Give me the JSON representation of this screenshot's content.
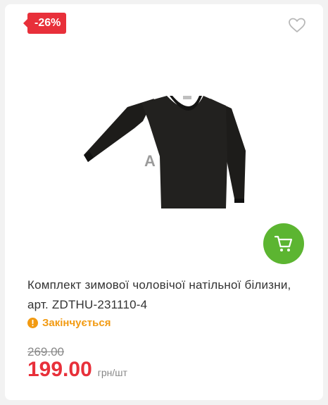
{
  "badge": {
    "discount": "-26%"
  },
  "icons": {
    "wishlist": "heart-icon",
    "cart": "cart-icon",
    "status": "exclamation-icon"
  },
  "product": {
    "title": "Комплект зимової чоловічої натільної білизни, арт. ZDTHU-231110-4",
    "status": "Закінчується",
    "old_price": "269.00",
    "price": "199.00",
    "unit": "грн/шт"
  },
  "colors": {
    "badge": "#e8303a",
    "cart_button": "#5cb531",
    "status": "#f29a11",
    "price": "#e8303a"
  }
}
